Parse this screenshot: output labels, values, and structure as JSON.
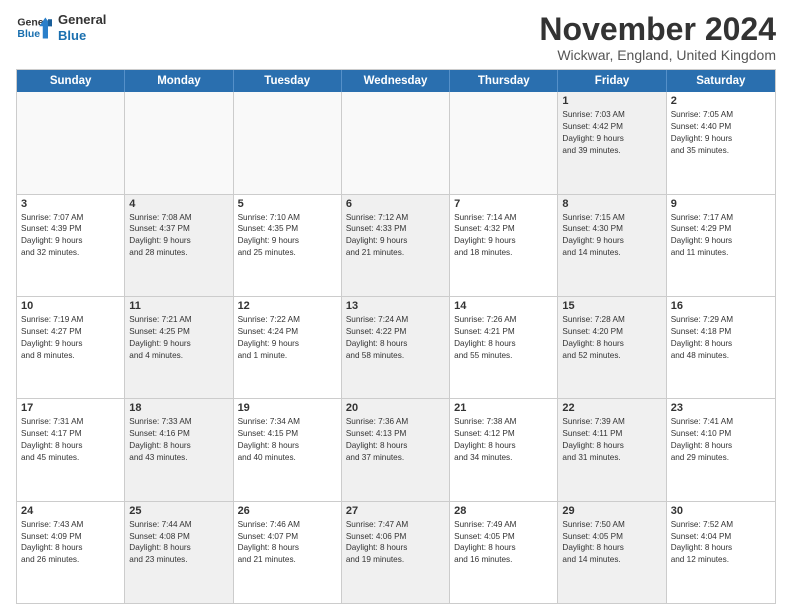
{
  "header": {
    "logo_line1": "General",
    "logo_line2": "Blue",
    "month_title": "November 2024",
    "location": "Wickwar, England, United Kingdom"
  },
  "weekdays": [
    "Sunday",
    "Monday",
    "Tuesday",
    "Wednesday",
    "Thursday",
    "Friday",
    "Saturday"
  ],
  "weeks": [
    [
      {
        "day": "",
        "info": "",
        "empty": true
      },
      {
        "day": "",
        "info": "",
        "empty": true
      },
      {
        "day": "",
        "info": "",
        "empty": true
      },
      {
        "day": "",
        "info": "",
        "empty": true
      },
      {
        "day": "",
        "info": "",
        "empty": true
      },
      {
        "day": "1",
        "info": "Sunrise: 7:03 AM\nSunset: 4:42 PM\nDaylight: 9 hours\nand 39 minutes.",
        "shaded": true
      },
      {
        "day": "2",
        "info": "Sunrise: 7:05 AM\nSunset: 4:40 PM\nDaylight: 9 hours\nand 35 minutes.",
        "shaded": false
      }
    ],
    [
      {
        "day": "3",
        "info": "Sunrise: 7:07 AM\nSunset: 4:39 PM\nDaylight: 9 hours\nand 32 minutes.",
        "shaded": false
      },
      {
        "day": "4",
        "info": "Sunrise: 7:08 AM\nSunset: 4:37 PM\nDaylight: 9 hours\nand 28 minutes.",
        "shaded": true
      },
      {
        "day": "5",
        "info": "Sunrise: 7:10 AM\nSunset: 4:35 PM\nDaylight: 9 hours\nand 25 minutes.",
        "shaded": false
      },
      {
        "day": "6",
        "info": "Sunrise: 7:12 AM\nSunset: 4:33 PM\nDaylight: 9 hours\nand 21 minutes.",
        "shaded": true
      },
      {
        "day": "7",
        "info": "Sunrise: 7:14 AM\nSunset: 4:32 PM\nDaylight: 9 hours\nand 18 minutes.",
        "shaded": false
      },
      {
        "day": "8",
        "info": "Sunrise: 7:15 AM\nSunset: 4:30 PM\nDaylight: 9 hours\nand 14 minutes.",
        "shaded": true
      },
      {
        "day": "9",
        "info": "Sunrise: 7:17 AM\nSunset: 4:29 PM\nDaylight: 9 hours\nand 11 minutes.",
        "shaded": false
      }
    ],
    [
      {
        "day": "10",
        "info": "Sunrise: 7:19 AM\nSunset: 4:27 PM\nDaylight: 9 hours\nand 8 minutes.",
        "shaded": false
      },
      {
        "day": "11",
        "info": "Sunrise: 7:21 AM\nSunset: 4:25 PM\nDaylight: 9 hours\nand 4 minutes.",
        "shaded": true
      },
      {
        "day": "12",
        "info": "Sunrise: 7:22 AM\nSunset: 4:24 PM\nDaylight: 9 hours\nand 1 minute.",
        "shaded": false
      },
      {
        "day": "13",
        "info": "Sunrise: 7:24 AM\nSunset: 4:22 PM\nDaylight: 8 hours\nand 58 minutes.",
        "shaded": true
      },
      {
        "day": "14",
        "info": "Sunrise: 7:26 AM\nSunset: 4:21 PM\nDaylight: 8 hours\nand 55 minutes.",
        "shaded": false
      },
      {
        "day": "15",
        "info": "Sunrise: 7:28 AM\nSunset: 4:20 PM\nDaylight: 8 hours\nand 52 minutes.",
        "shaded": true
      },
      {
        "day": "16",
        "info": "Sunrise: 7:29 AM\nSunset: 4:18 PM\nDaylight: 8 hours\nand 48 minutes.",
        "shaded": false
      }
    ],
    [
      {
        "day": "17",
        "info": "Sunrise: 7:31 AM\nSunset: 4:17 PM\nDaylight: 8 hours\nand 45 minutes.",
        "shaded": false
      },
      {
        "day": "18",
        "info": "Sunrise: 7:33 AM\nSunset: 4:16 PM\nDaylight: 8 hours\nand 43 minutes.",
        "shaded": true
      },
      {
        "day": "19",
        "info": "Sunrise: 7:34 AM\nSunset: 4:15 PM\nDaylight: 8 hours\nand 40 minutes.",
        "shaded": false
      },
      {
        "day": "20",
        "info": "Sunrise: 7:36 AM\nSunset: 4:13 PM\nDaylight: 8 hours\nand 37 minutes.",
        "shaded": true
      },
      {
        "day": "21",
        "info": "Sunrise: 7:38 AM\nSunset: 4:12 PM\nDaylight: 8 hours\nand 34 minutes.",
        "shaded": false
      },
      {
        "day": "22",
        "info": "Sunrise: 7:39 AM\nSunset: 4:11 PM\nDaylight: 8 hours\nand 31 minutes.",
        "shaded": true
      },
      {
        "day": "23",
        "info": "Sunrise: 7:41 AM\nSunset: 4:10 PM\nDaylight: 8 hours\nand 29 minutes.",
        "shaded": false
      }
    ],
    [
      {
        "day": "24",
        "info": "Sunrise: 7:43 AM\nSunset: 4:09 PM\nDaylight: 8 hours\nand 26 minutes.",
        "shaded": false
      },
      {
        "day": "25",
        "info": "Sunrise: 7:44 AM\nSunset: 4:08 PM\nDaylight: 8 hours\nand 23 minutes.",
        "shaded": true
      },
      {
        "day": "26",
        "info": "Sunrise: 7:46 AM\nSunset: 4:07 PM\nDaylight: 8 hours\nand 21 minutes.",
        "shaded": false
      },
      {
        "day": "27",
        "info": "Sunrise: 7:47 AM\nSunset: 4:06 PM\nDaylight: 8 hours\nand 19 minutes.",
        "shaded": true
      },
      {
        "day": "28",
        "info": "Sunrise: 7:49 AM\nSunset: 4:05 PM\nDaylight: 8 hours\nand 16 minutes.",
        "shaded": false
      },
      {
        "day": "29",
        "info": "Sunrise: 7:50 AM\nSunset: 4:05 PM\nDaylight: 8 hours\nand 14 minutes.",
        "shaded": true
      },
      {
        "day": "30",
        "info": "Sunrise: 7:52 AM\nSunset: 4:04 PM\nDaylight: 8 hours\nand 12 minutes.",
        "shaded": false
      }
    ]
  ]
}
